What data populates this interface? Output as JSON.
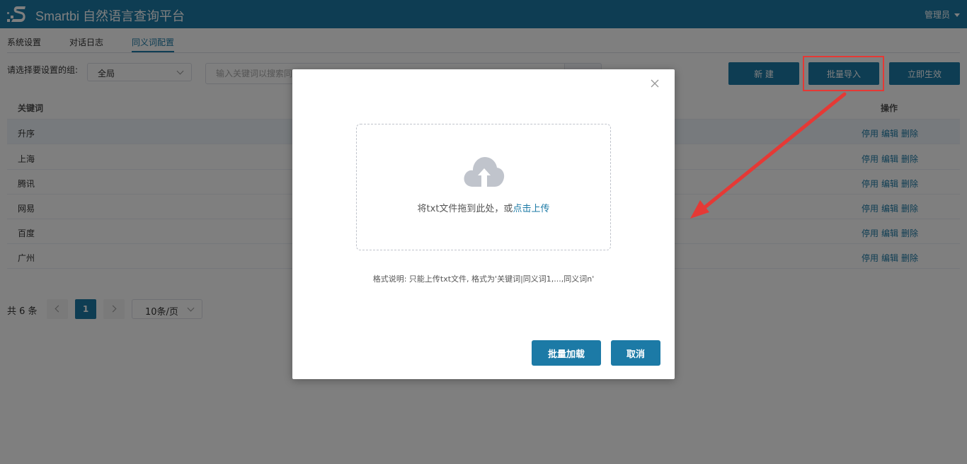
{
  "header": {
    "title": "Smartbi 自然语言查询平台",
    "user": "管理员"
  },
  "tabs": [
    {
      "label": "系统设置"
    },
    {
      "label": "对话日志"
    },
    {
      "label": "同义词配置"
    }
  ],
  "filter": {
    "label": "请选择要设置的组:",
    "group_value": "全局",
    "search_placeholder": "输入关键词以搜索同"
  },
  "toolbar": {
    "new_label": "新 建",
    "import_label": "批量导入",
    "apply_label": "立即生效"
  },
  "table": {
    "headers": {
      "keyword": "关键词",
      "actions": "操作"
    },
    "rows": [
      {
        "keyword": "升序"
      },
      {
        "keyword": "上海"
      },
      {
        "keyword": "腾讯"
      },
      {
        "keyword": "网易"
      },
      {
        "keyword": "百度"
      },
      {
        "keyword": "广州"
      }
    ],
    "actions": {
      "disable": "停用",
      "edit": "编辑",
      "delete": "删除"
    }
  },
  "pagination": {
    "total_text": "共 6 条",
    "current_page": "1",
    "page_size": "10条/页"
  },
  "modal": {
    "drop_text": "将txt文件拖到此处，或",
    "drop_link": "点击上传",
    "format_text": "格式说明: 只能上传txt文件, 格式为'关键词|同义词1,...,同义词n'",
    "load_label": "批量加载",
    "cancel_label": "取消"
  },
  "colors": {
    "primary": "#1c7aa6",
    "annotation": "#e53935"
  },
  "icons": {
    "logo": "smartbi-logo",
    "upload": "cloud-upload-icon",
    "close": "close-icon"
  }
}
